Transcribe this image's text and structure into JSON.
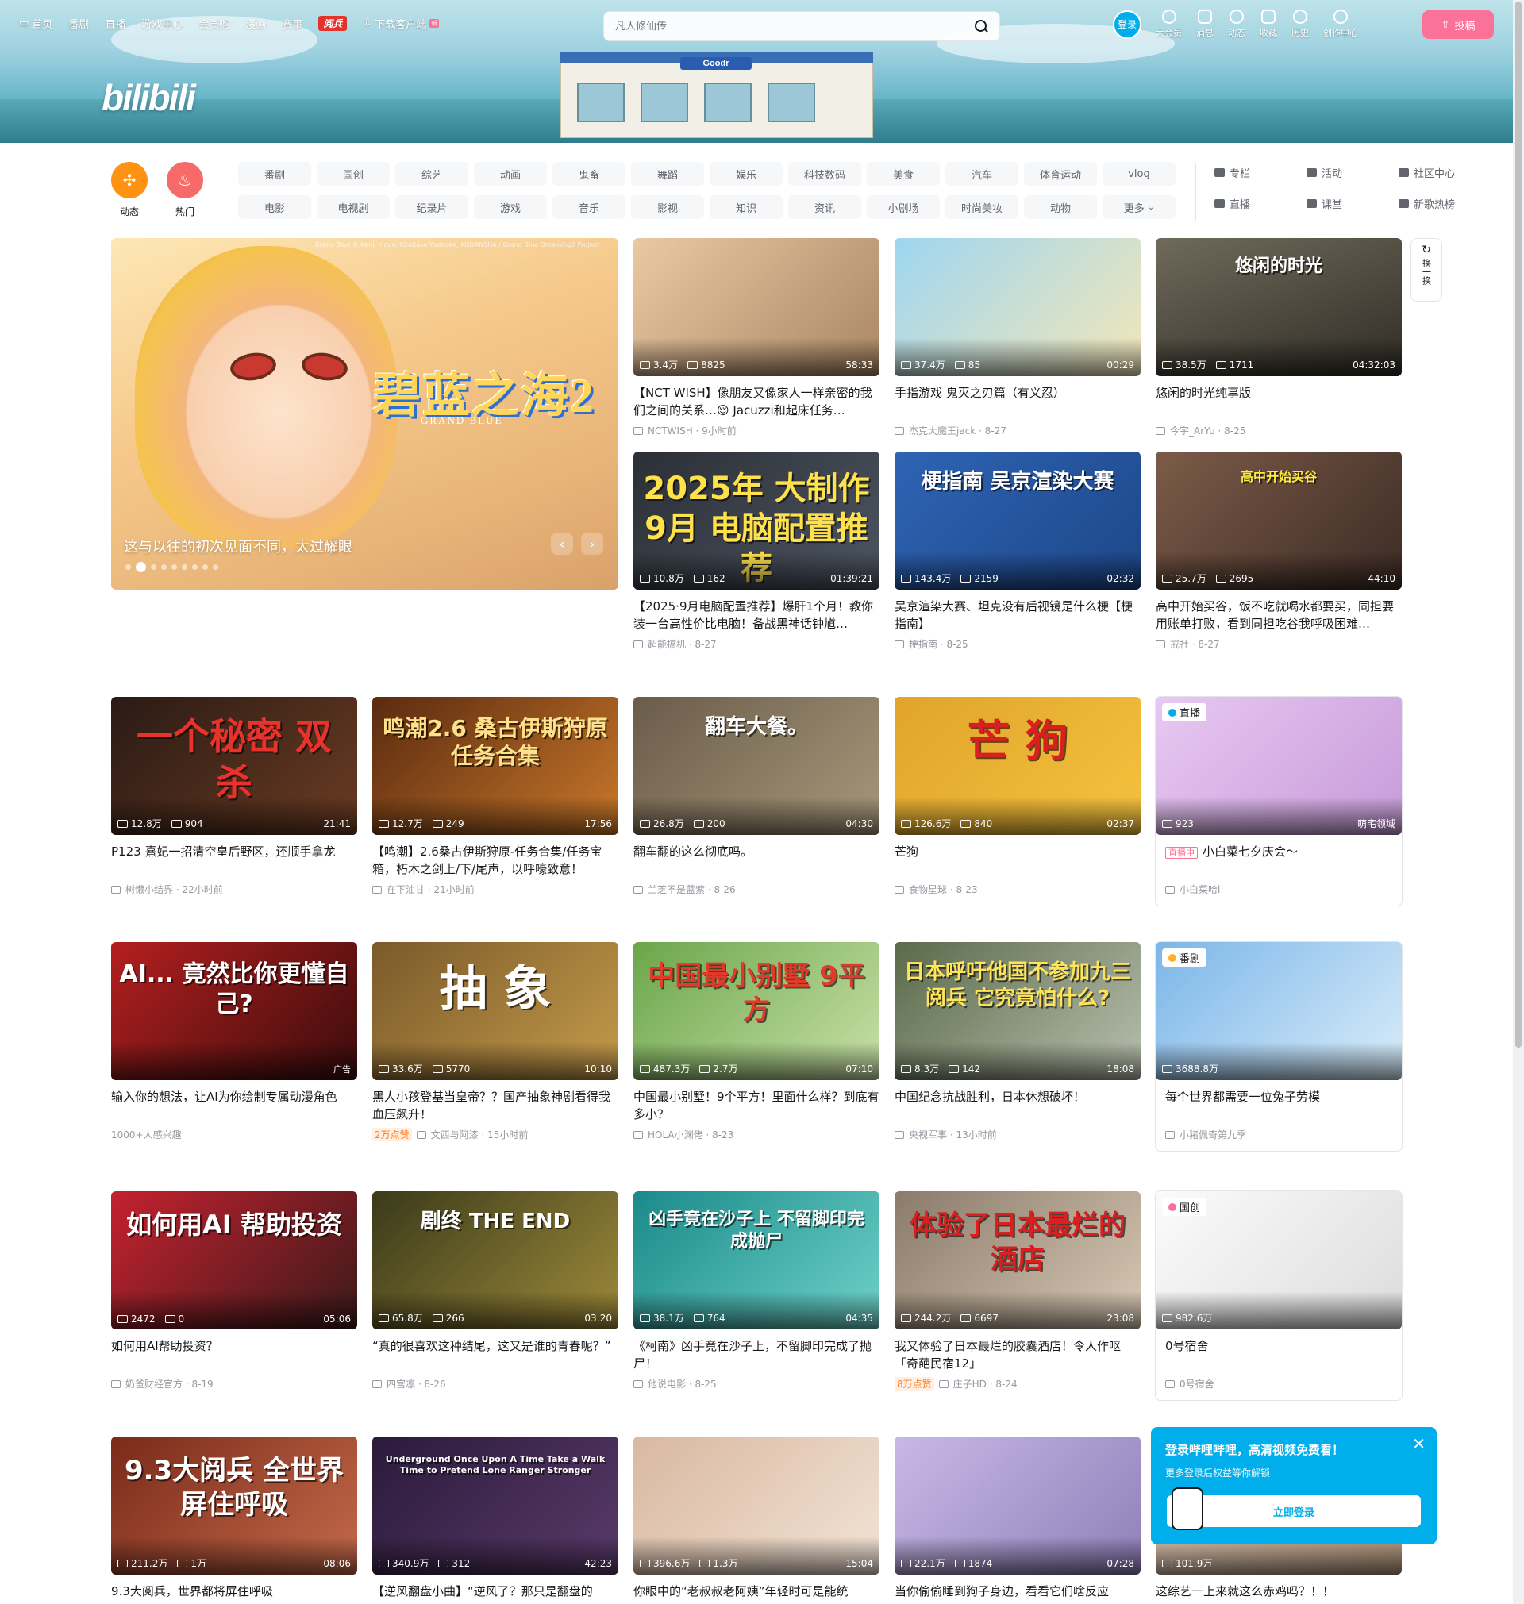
{
  "topnav": {
    "items": [
      "首页",
      "番剧",
      "直播",
      "游戏中心",
      "会员购",
      "漫画",
      "赛事"
    ],
    "badge": "阅兵",
    "download": "下载客户端",
    "new_tag": "新"
  },
  "search": {
    "placeholder": "凡人修仙传"
  },
  "rightnav": {
    "login": "登录",
    "items": [
      "大会员",
      "消息",
      "动态",
      "收藏",
      "历史",
      "创作中心"
    ],
    "upload": "投稿"
  },
  "logo": "bilibili",
  "channels": {
    "dynamic": "动态",
    "hot": "热门",
    "list": [
      "番剧",
      "国创",
      "综艺",
      "动画",
      "鬼畜",
      "舞蹈",
      "娱乐",
      "科技数码",
      "美食",
      "汽车",
      "体育运动",
      "vlog",
      "电影",
      "电视剧",
      "纪录片",
      "游戏",
      "音乐",
      "影视",
      "知识",
      "资讯",
      "小剧场",
      "时尚美妆",
      "动物",
      "更多"
    ],
    "side": [
      "专栏",
      "活动",
      "社区中心",
      "直播",
      "课堂",
      "新歌热榜"
    ]
  },
  "carousel": {
    "title_art": "碧蓝之海2",
    "title_sub": "GRAND BLUE",
    "caption": "这与以往的初次见面不同，太过耀眼",
    "copyright": "Grand Blue © Kenji Inoue, Kimitake Yoshioka, KODANSHA / Grand Blue Dreaming2 Project",
    "prev": "‹",
    "next": "›"
  },
  "refresh": {
    "label": "换一换"
  },
  "cards": [
    {
      "views": "3.4万",
      "danmaku": "8825",
      "duration": "58:33",
      "title": "【NCT WISH】像朋友又像家人一样亲密的我们之间的关系…😌 Jacuzzi和起床任务…",
      "up": "NCTWISH",
      "time": "9小时前"
    },
    {
      "views": "37.4万",
      "danmaku": "85",
      "duration": "00:29",
      "title": "手指游戏 鬼灭之刃篇（有义忍）",
      "up": "杰克大魔王jack",
      "time": "8-27"
    },
    {
      "views": "38.5万",
      "danmaku": "1711",
      "duration": "04:32:03",
      "title": "悠闲的时光纯享版",
      "up": "今宇_ArYu",
      "time": "8-25",
      "art": "悠闲的时光"
    },
    {
      "views": "10.8万",
      "danmaku": "162",
      "duration": "01:39:21",
      "title": "【2025·9月电脑配置推荐】爆肝1个月！教你装一台高性价比电脑！备战黑神话钟馗…",
      "up": "超能搞机",
      "time": "8-27",
      "art": "2025年 大制作 9月 电脑配置推荐"
    },
    {
      "views": "143.4万",
      "danmaku": "2159",
      "duration": "02:32",
      "title": "吴京渲染大赛、坦克没有后视镜是什么梗【梗指南】",
      "up": "梗指南",
      "time": "8-25",
      "art": "梗指南 吴京渲染大赛"
    },
    {
      "views": "25.7万",
      "danmaku": "2695",
      "duration": "44:10",
      "title": "高中开始买谷，饭不吃就喝水都要买，同担要用账单打败，看到同担吃谷我呼吸困难…",
      "up": "戒社",
      "time": "8-27",
      "art": "高中开始买谷"
    },
    {
      "views": "12.8万",
      "danmaku": "904",
      "duration": "21:41",
      "title": "P123 熹妃一招清空皇后野区，还顺手拿龙",
      "up": "树懒小结界",
      "time": "22小时前",
      "art": "一个秘密 双杀"
    },
    {
      "views": "12.7万",
      "danmaku": "249",
      "duration": "17:56",
      "title": "【鸣潮】2.6桑古伊斯狩原-任务合集/任务宝箱，朽木之剑上/下/尾声，以呼嚎致意！",
      "up": "在下油甘",
      "time": "21小时前",
      "art": "鸣潮2.6 桑古伊斯狩原 任务合集"
    },
    {
      "views": "26.8万",
      "danmaku": "200",
      "duration": "04:30",
      "title": "翻车翻的这么彻底吗。",
      "up": "兰芝不是蓝紫",
      "time": "8-26",
      "art": "翻车大餐。"
    },
    {
      "views": "126.6万",
      "danmaku": "840",
      "duration": "02:37",
      "title": "芒狗",
      "up": "食物星球",
      "time": "8-23",
      "art": "芒 狗"
    },
    {
      "live": "直播",
      "viewers": "923",
      "room": "萌宅领域",
      "live_tag": "直播中",
      "title": "小白菜七夕庆会～",
      "up": "小白菜哈i"
    },
    {
      "views": "",
      "danmaku": "",
      "duration": "",
      "ad": "广告",
      "title": "输入你的想法，让AI为你绘制专属动漫角色",
      "up": "1000+人感兴趣",
      "art": "AI... 竟然比你更懂自己?"
    },
    {
      "views": "33.6万",
      "danmaku": "5770",
      "duration": "10:10",
      "title": "黑人小孩登基当皇帝？？国产抽象神剧看得我血压飙升！",
      "up": "文西与阿漆",
      "time": "15小时前",
      "tag": "2万点赞",
      "art": "抽 象"
    },
    {
      "views": "487.3万",
      "danmaku": "2.7万",
      "duration": "07:10",
      "title": "中国最小别墅！9个平方！里面什么样？到底有多小？",
      "up": "HOLA小渊佬",
      "time": "8-23",
      "art": "中国最小别墅 9平方"
    },
    {
      "views": "8.3万",
      "danmaku": "142",
      "duration": "18:08",
      "title": "中国纪念抗战胜利，日本休想破坏！",
      "up": "央视军事",
      "time": "13小时前",
      "art": "日本呼吁他国不参加九三阅兵 它究竟怕什么?"
    },
    {
      "chip": "番剧",
      "views": "3688.8万",
      "title": "每个世界都需要一位兔子劳模",
      "up": "小猪佩奇第九季"
    },
    {
      "views": "2472",
      "danmaku": "0",
      "duration": "05:06",
      "title": "如何用AI帮助投资？",
      "up": "奶爸财经官方",
      "time": "8-19",
      "art": "如何用AI 帮助投资"
    },
    {
      "views": "65.8万",
      "danmaku": "266",
      "duration": "03:20",
      "title": "“真的很喜欢这种结尾，这又是谁的青春呢？”",
      "up": "四宫凛",
      "time": "8-26",
      "art": "剧终 THE END"
    },
    {
      "views": "38.1万",
      "danmaku": "764",
      "duration": "04:35",
      "title": "《柯南》凶手竟在沙子上，不留脚印完成了抛尸！",
      "up": "他说电影",
      "time": "8-25",
      "art": "凶手竟在沙子上 不留脚印完成抛尸"
    },
    {
      "views": "244.2万",
      "danmaku": "6697",
      "duration": "23:08",
      "title": "我又体验了日本最烂的胶囊酒店！令人作呕「奇葩民宿12」",
      "up": "庄子HD",
      "time": "8-24",
      "tag": "8万点赞",
      "art": "体验了日本最烂的酒店"
    },
    {
      "chip": "国创",
      "views": "982.6万",
      "title": "0号宿舍",
      "up": "0号宿舍"
    },
    {
      "views": "211.2万",
      "danmaku": "1万",
      "duration": "08:06",
      "title": "9.3大阅兵，世界都将屏住呼吸",
      "art": "9.3大阅兵 全世界 屏住呼吸"
    },
    {
      "views": "340.9万",
      "danmaku": "312",
      "duration": "42:23",
      "title": "【逆风翻盘小曲】“逆风了？那只是翻盘的",
      "art": "Underground Once Upon A Time Take a Walk Time to Pretend Lone Ranger Stronger"
    },
    {
      "views": "396.6万",
      "danmaku": "1.3万",
      "duration": "15:04",
      "title": "你眼中的“老叔叔老阿姨”年轻时可是能统"
    },
    {
      "views": "22.1万",
      "danmaku": "1874",
      "duration": "07:28",
      "title": "当你偷偷睡到狗子身边，看看它们啥反应"
    },
    {
      "views": "101.9万",
      "title": "这综艺一上来就这么赤鸡吗？！！"
    }
  ],
  "login_popup": {
    "title": "登录哔哩哔哩，高清视频免费看！",
    "sub": "更多登录后权益等你解锁",
    "button": "立即登录",
    "close": "✕"
  }
}
